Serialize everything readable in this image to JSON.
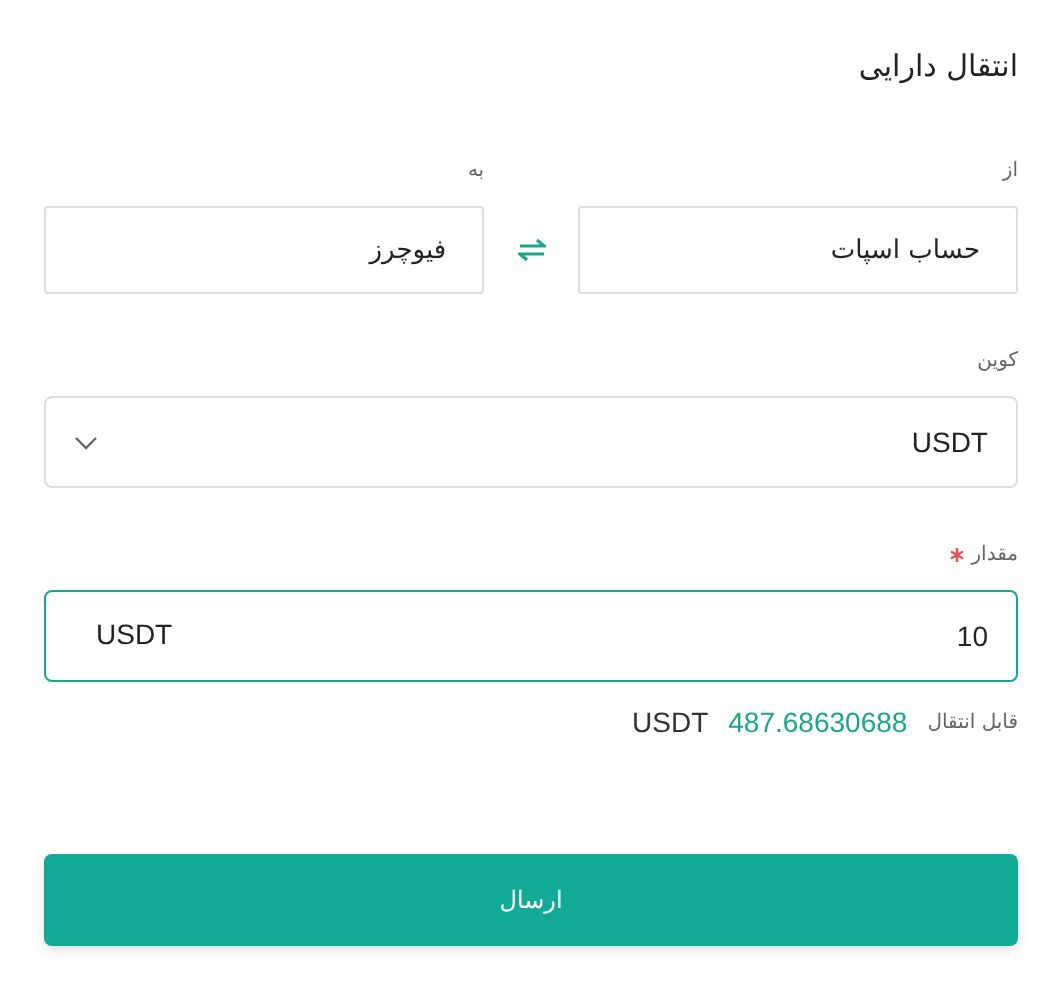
{
  "dialog": {
    "title": "انتقال دارایی"
  },
  "from": {
    "label": "از",
    "value": "حساب اسپات"
  },
  "to": {
    "label": "به",
    "value": "فیوچرز"
  },
  "coin": {
    "label": "کوین",
    "value": "USDT"
  },
  "amount": {
    "label": "مقدار",
    "required": true,
    "value": "10",
    "unit": "USDT",
    "focused": true
  },
  "available": {
    "label": "قابل انتقال",
    "value": "487.68630688",
    "unit": "USDT"
  },
  "submit": {
    "label": "ارسال"
  }
}
